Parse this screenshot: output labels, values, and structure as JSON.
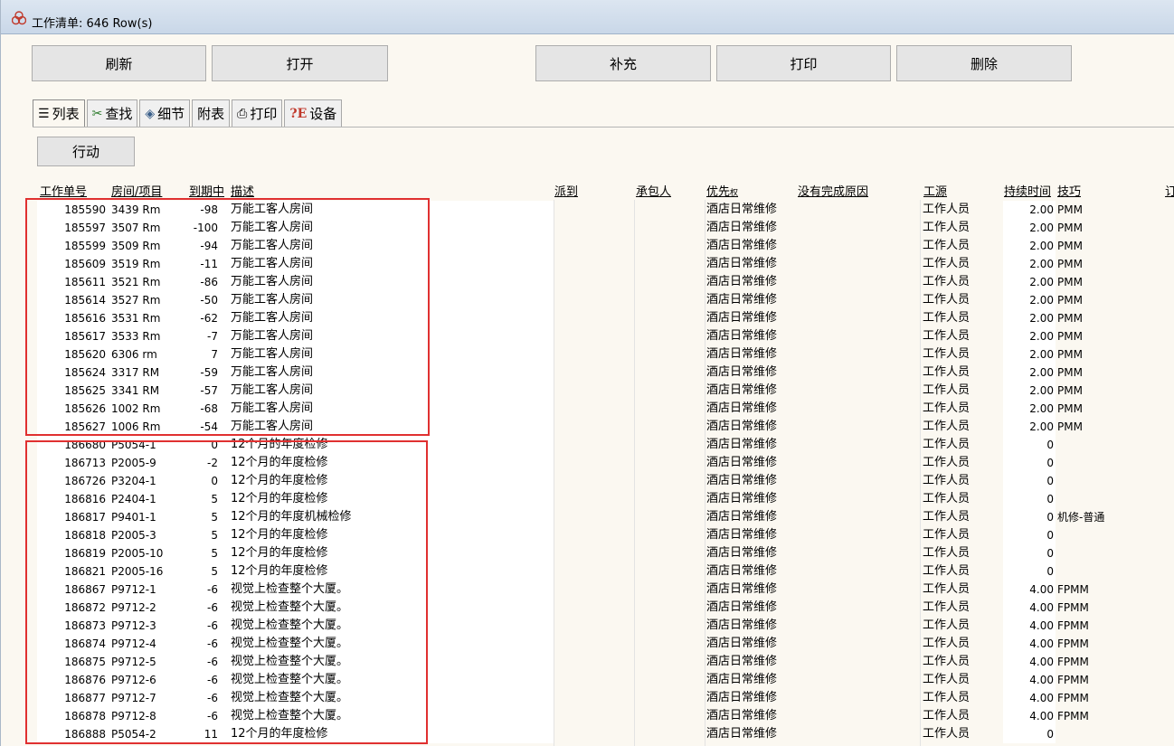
{
  "window": {
    "title": "工作清单: 646 Row(s)",
    "icon": "app-biohazard-icon"
  },
  "toolbar": {
    "refresh": "刷新",
    "open": "打开",
    "supplement": "补充",
    "print": "打印",
    "delete": "删除"
  },
  "tabs": [
    {
      "label": "列表",
      "icon": "list-icon",
      "glyph": "☰"
    },
    {
      "label": "查找",
      "icon": "find-icon",
      "glyph": "⚲"
    },
    {
      "label": "细节",
      "icon": "detail-icon",
      "glyph": "✎"
    },
    {
      "label": "附表",
      "icon": "",
      "glyph": ""
    },
    {
      "label": "打印",
      "icon": "printer-icon",
      "glyph": "⎙"
    },
    {
      "label": "设备",
      "icon": "equipment-icon",
      "glyph": "?E"
    }
  ],
  "action_button": "行动",
  "columns": {
    "id": "工作单号",
    "room": "房间/项目",
    "due": "到期中",
    "desc": "描述",
    "assigned": "派到",
    "contractor": "承包人",
    "priority": "优先",
    "priority_sub": "权",
    "reason": "没有完成原因",
    "source": "工源",
    "duration": "持续时间",
    "skill": "技巧",
    "extra": "订"
  },
  "rows": [
    {
      "id": "185590",
      "room": "3439 Rm",
      "due": "-98",
      "desc": "万能工客人房间",
      "priority": "酒店日常维修",
      "source": "工作人员",
      "duration": "2.00",
      "skill": "PMM"
    },
    {
      "id": "185597",
      "room": "3507 Rm",
      "due": "-100",
      "desc": "万能工客人房间",
      "priority": "酒店日常维修",
      "source": "工作人员",
      "duration": "2.00",
      "skill": "PMM"
    },
    {
      "id": "185599",
      "room": "3509 Rm",
      "due": "-94",
      "desc": "万能工客人房间",
      "priority": "酒店日常维修",
      "source": "工作人员",
      "duration": "2.00",
      "skill": "PMM"
    },
    {
      "id": "185609",
      "room": "3519 Rm",
      "due": "-11",
      "desc": "万能工客人房间",
      "priority": "酒店日常维修",
      "source": "工作人员",
      "duration": "2.00",
      "skill": "PMM"
    },
    {
      "id": "185611",
      "room": "3521 Rm",
      "due": "-86",
      "desc": "万能工客人房间",
      "priority": "酒店日常维修",
      "source": "工作人员",
      "duration": "2.00",
      "skill": "PMM"
    },
    {
      "id": "185614",
      "room": "3527 Rm",
      "due": "-50",
      "desc": "万能工客人房间",
      "priority": "酒店日常维修",
      "source": "工作人员",
      "duration": "2.00",
      "skill": "PMM"
    },
    {
      "id": "185616",
      "room": "3531 Rm",
      "due": "-62",
      "desc": "万能工客人房间",
      "priority": "酒店日常维修",
      "source": "工作人员",
      "duration": "2.00",
      "skill": "PMM"
    },
    {
      "id": "185617",
      "room": "3533 Rm",
      "due": "-7",
      "desc": "万能工客人房间",
      "priority": "酒店日常维修",
      "source": "工作人员",
      "duration": "2.00",
      "skill": "PMM"
    },
    {
      "id": "185620",
      "room": "6306 rm",
      "due": "7",
      "desc": "万能工客人房间",
      "priority": "酒店日常维修",
      "source": "工作人员",
      "duration": "2.00",
      "skill": "PMM"
    },
    {
      "id": "185624",
      "room": "3317 RM",
      "due": "-59",
      "desc": "万能工客人房间",
      "priority": "酒店日常维修",
      "source": "工作人员",
      "duration": "2.00",
      "skill": "PMM"
    },
    {
      "id": "185625",
      "room": "3341 RM",
      "due": "-57",
      "desc": "万能工客人房间",
      "priority": "酒店日常维修",
      "source": "工作人员",
      "duration": "2.00",
      "skill": "PMM"
    },
    {
      "id": "185626",
      "room": "1002 Rm",
      "due": "-68",
      "desc": "万能工客人房间",
      "priority": "酒店日常维修",
      "source": "工作人员",
      "duration": "2.00",
      "skill": "PMM"
    },
    {
      "id": "185627",
      "room": "1006 Rm",
      "due": "-54",
      "desc": "万能工客人房间",
      "priority": "酒店日常维修",
      "source": "工作人员",
      "duration": "2.00",
      "skill": "PMM"
    },
    {
      "id": "186680",
      "room": "P5054-1",
      "due": "0",
      "desc": "12个月的年度检修",
      "priority": "酒店日常维修",
      "source": "工作人员",
      "duration": "0",
      "skill": ""
    },
    {
      "id": "186713",
      "room": "P2005-9",
      "due": "-2",
      "desc": "12个月的年度检修",
      "priority": "酒店日常维修",
      "source": "工作人员",
      "duration": "0",
      "skill": ""
    },
    {
      "id": "186726",
      "room": "P3204-1",
      "due": "0",
      "desc": "12个月的年度检修",
      "priority": "酒店日常维修",
      "source": "工作人员",
      "duration": "0",
      "skill": ""
    },
    {
      "id": "186816",
      "room": "P2404-1",
      "due": "5",
      "desc": "12个月的年度检修",
      "priority": "酒店日常维修",
      "source": "工作人员",
      "duration": "0",
      "skill": ""
    },
    {
      "id": "186817",
      "room": "P9401-1",
      "due": "5",
      "desc": "12个月的年度机械检修",
      "priority": "酒店日常维修",
      "source": "工作人员",
      "duration": "0",
      "skill": "机修-普通"
    },
    {
      "id": "186818",
      "room": "P2005-3",
      "due": "5",
      "desc": "12个月的年度检修",
      "priority": "酒店日常维修",
      "source": "工作人员",
      "duration": "0",
      "skill": ""
    },
    {
      "id": "186819",
      "room": "P2005-10",
      "due": "5",
      "desc": "12个月的年度检修",
      "priority": "酒店日常维修",
      "source": "工作人员",
      "duration": "0",
      "skill": ""
    },
    {
      "id": "186821",
      "room": "P2005-16",
      "due": "5",
      "desc": "12个月的年度检修",
      "priority": "酒店日常维修",
      "source": "工作人员",
      "duration": "0",
      "skill": ""
    },
    {
      "id": "186867",
      "room": "P9712-1",
      "due": "-6",
      "desc": "视觉上检查整个大厦。",
      "priority": "酒店日常维修",
      "source": "工作人员",
      "duration": "4.00",
      "skill": "FPMM"
    },
    {
      "id": "186872",
      "room": "P9712-2",
      "due": "-6",
      "desc": "视觉上检查整个大厦。",
      "priority": "酒店日常维修",
      "source": "工作人员",
      "duration": "4.00",
      "skill": "FPMM"
    },
    {
      "id": "186873",
      "room": "P9712-3",
      "due": "-6",
      "desc": "视觉上检查整个大厦。",
      "priority": "酒店日常维修",
      "source": "工作人员",
      "duration": "4.00",
      "skill": "FPMM"
    },
    {
      "id": "186874",
      "room": "P9712-4",
      "due": "-6",
      "desc": "视觉上检查整个大厦。",
      "priority": "酒店日常维修",
      "source": "工作人员",
      "duration": "4.00",
      "skill": "FPMM"
    },
    {
      "id": "186875",
      "room": "P9712-5",
      "due": "-6",
      "desc": "视觉上检查整个大厦。",
      "priority": "酒店日常维修",
      "source": "工作人员",
      "duration": "4.00",
      "skill": "FPMM"
    },
    {
      "id": "186876",
      "room": "P9712-6",
      "due": "-6",
      "desc": "视觉上检查整个大厦。",
      "priority": "酒店日常维修",
      "source": "工作人员",
      "duration": "4.00",
      "skill": "FPMM"
    },
    {
      "id": "186877",
      "room": "P9712-7",
      "due": "-6",
      "desc": "视觉上检查整个大厦。",
      "priority": "酒店日常维修",
      "source": "工作人员",
      "duration": "4.00",
      "skill": "FPMM"
    },
    {
      "id": "186878",
      "room": "P9712-8",
      "due": "-6",
      "desc": "视觉上检查整个大厦。",
      "priority": "酒店日常维修",
      "source": "工作人员",
      "duration": "4.00",
      "skill": "FPMM"
    },
    {
      "id": "186888",
      "room": "P5054-2",
      "due": "11",
      "desc": "12个月的年度检修",
      "priority": "酒店日常维修",
      "source": "工作人员",
      "duration": "0",
      "skill": ""
    }
  ],
  "highlight_color": "#e03030"
}
